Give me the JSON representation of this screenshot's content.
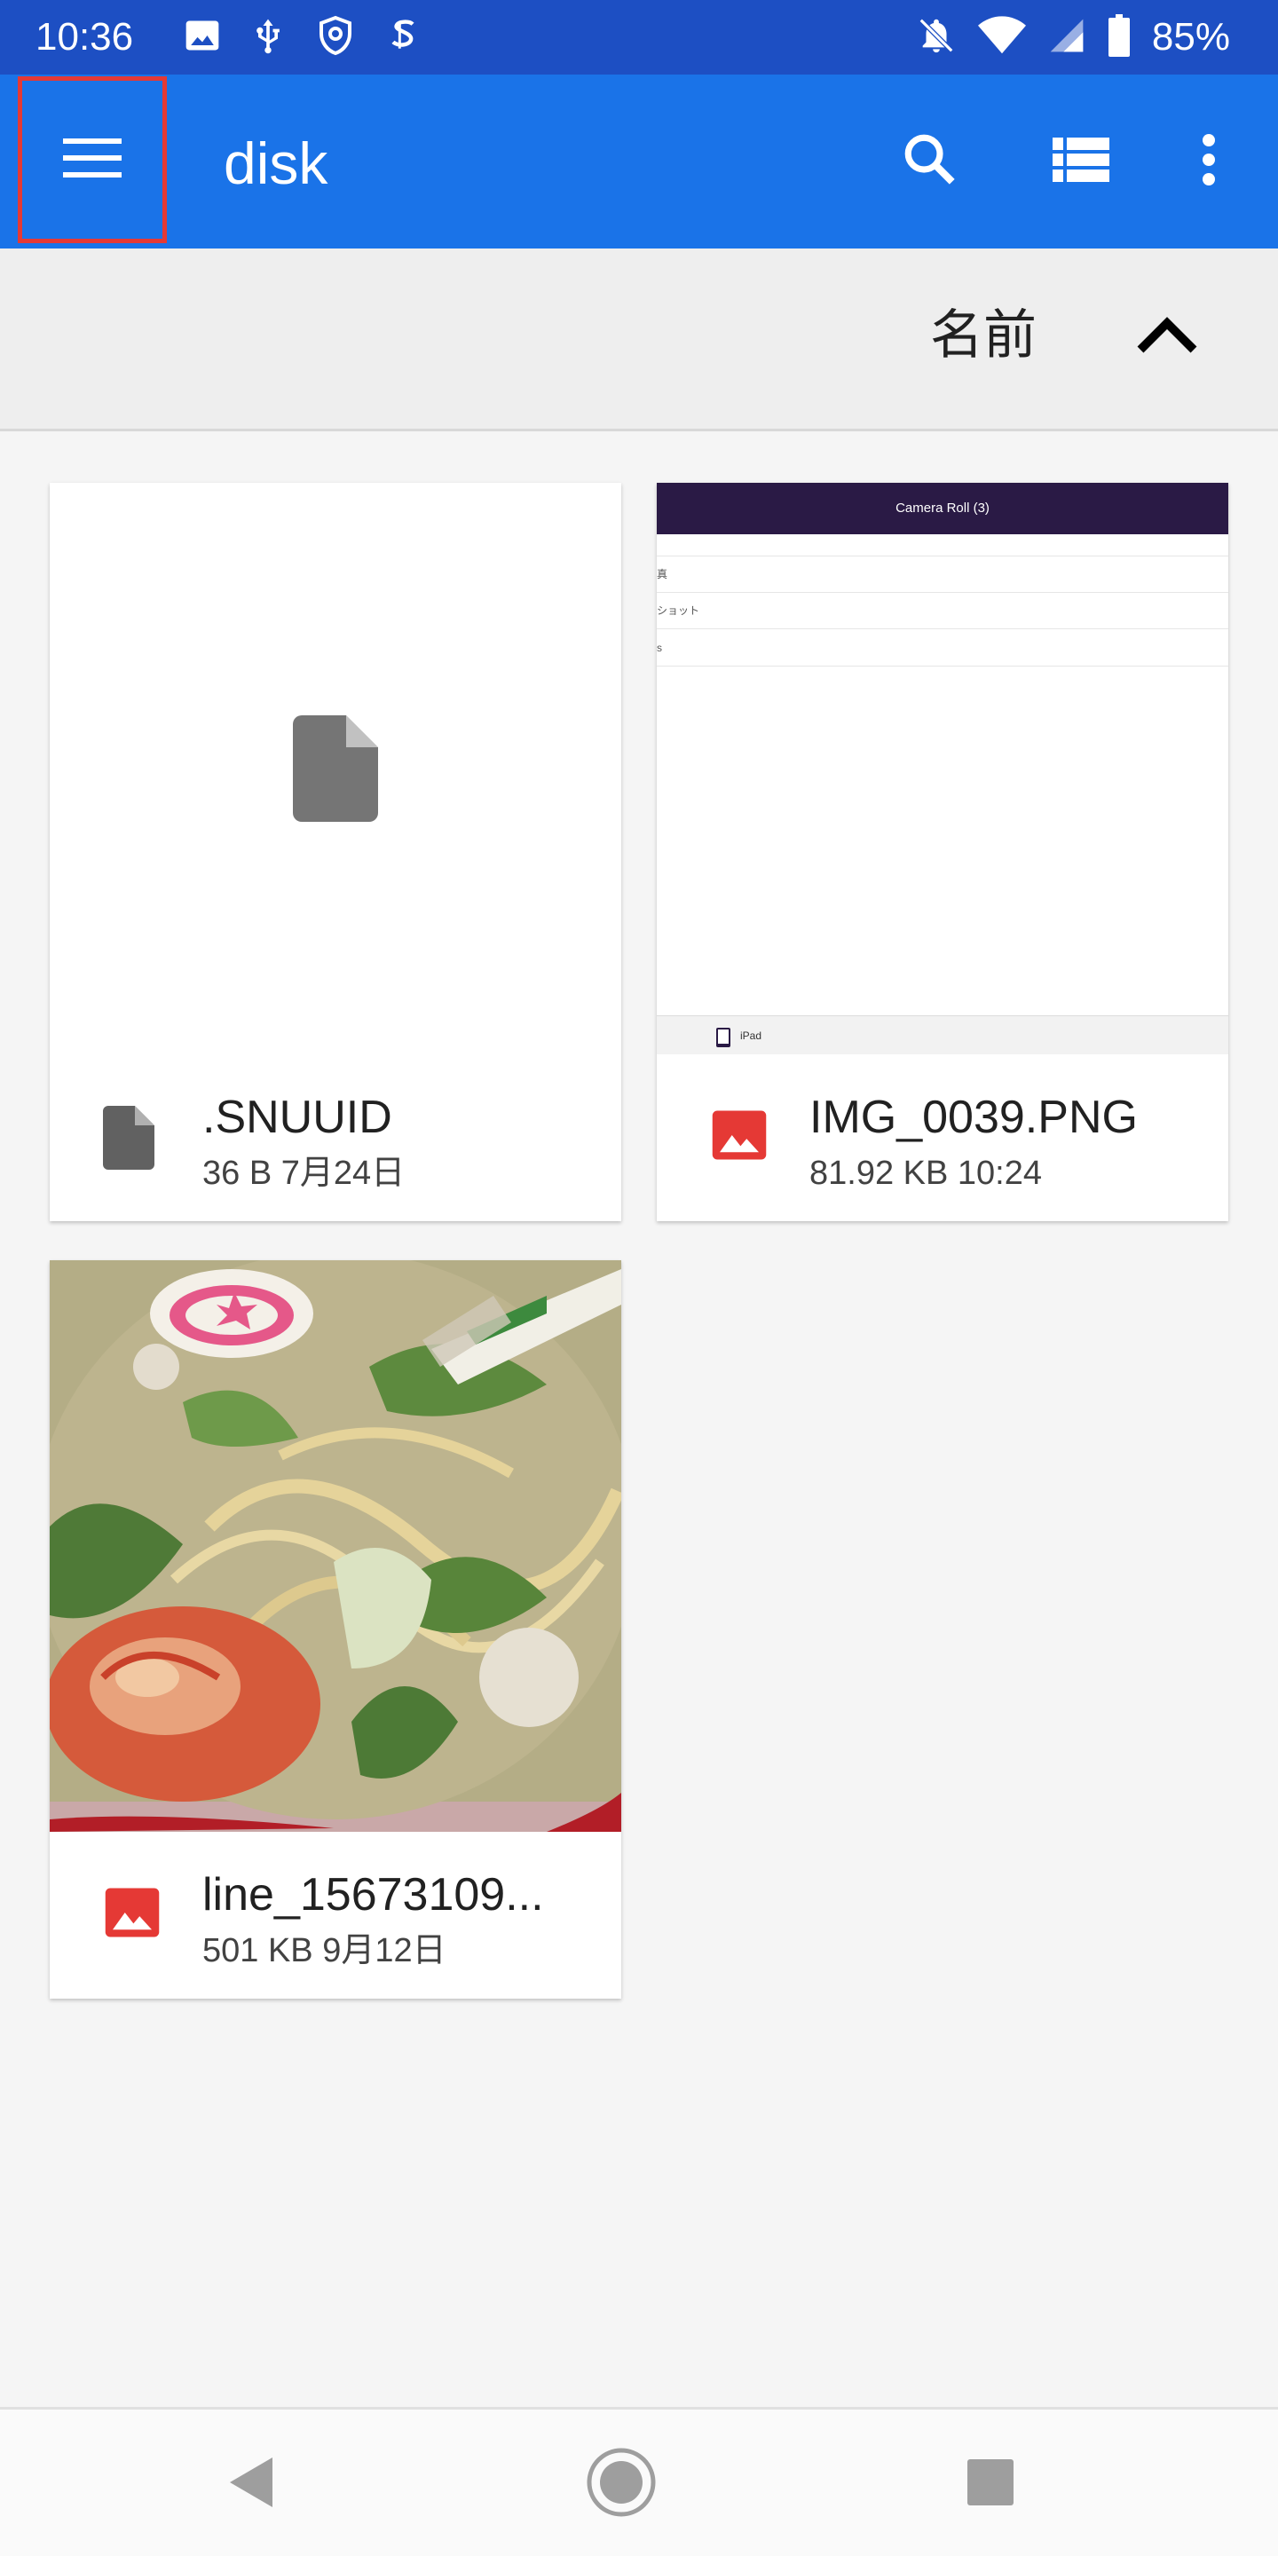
{
  "status_bar": {
    "time": "10:36",
    "battery": "85%",
    "icons_left": [
      "image-icon",
      "usb-icon",
      "shield-icon",
      "s-app-icon"
    ],
    "icons_right": [
      "notifications-off-icon",
      "wifi-icon",
      "signal-icon",
      "battery-icon"
    ]
  },
  "app_bar": {
    "title": "disk",
    "menu_icon": "hamburger-menu-icon",
    "actions": [
      "search-icon",
      "list-view-icon",
      "more-vert-icon"
    ]
  },
  "sort_bar": {
    "label": "名前",
    "direction_icon": "chevron-up-icon"
  },
  "files": [
    {
      "name": ".SNUUID",
      "meta": "36 B 7月24日",
      "type": "file",
      "icon": "file-icon"
    },
    {
      "name": "IMG_0039.PNG",
      "meta": "81.92 KB 10:24",
      "type": "image",
      "icon": "image-icon",
      "preview": {
        "header": "Camera Roll (3)",
        "rows": [
          "真",
          "ショット",
          "s"
        ],
        "footer": "iPad"
      }
    },
    {
      "name": "line_15673109...",
      "meta": "501 KB 9月12日",
      "type": "image",
      "icon": "image-icon"
    }
  ],
  "colors": {
    "status_bar": "#1d4fc3",
    "app_bar": "#1a73e8",
    "image_icon": "#e53935",
    "file_icon": "#616161",
    "highlight": "#e53935"
  },
  "nav_bar": [
    "back-icon",
    "home-icon",
    "recents-icon"
  ]
}
